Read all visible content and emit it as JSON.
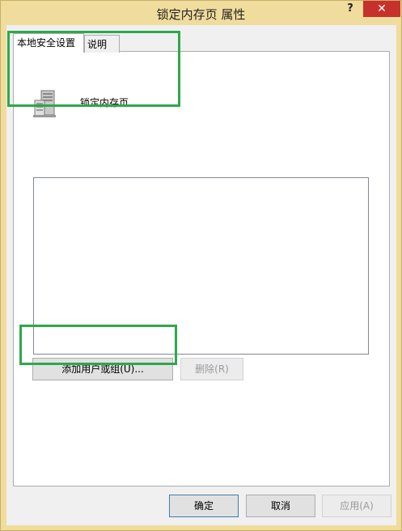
{
  "window": {
    "title": "锁定内存页 属性",
    "help_label": "?",
    "close_label": "✕"
  },
  "tabs": [
    {
      "label": "本地安全设置",
      "active": true
    },
    {
      "label": "说明",
      "active": false
    }
  ],
  "policy": {
    "icon": "server-icon",
    "name": "锁定内存页"
  },
  "members_list": {
    "items": []
  },
  "buttons": {
    "add": "添加用户或组(U)...",
    "remove": "删除(R)",
    "ok": "确定",
    "cancel": "取消",
    "apply": "应用(A)"
  },
  "colors": {
    "highlight": "#2ea84a",
    "close_button": "#c7312b",
    "window_frame": "#f0dc9c"
  }
}
